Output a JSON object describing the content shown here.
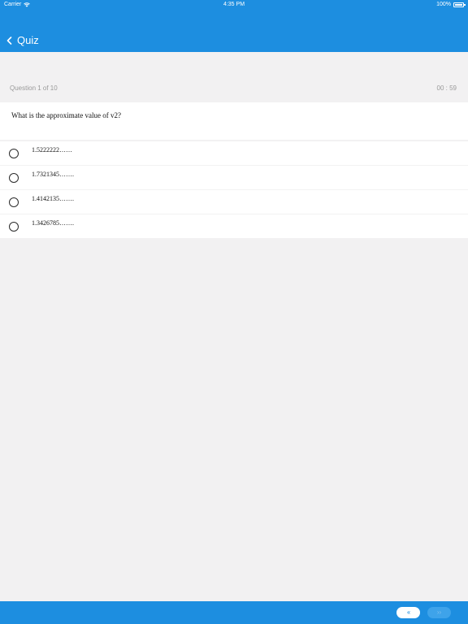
{
  "status_bar": {
    "carrier": "Carrier",
    "time": "4:35 PM",
    "battery": "100%",
    "battery_level": 1.0
  },
  "nav": {
    "title": "Quiz",
    "back_icon": "chevron-left-icon"
  },
  "quiz": {
    "counter": "Question 1 of 10",
    "timer": "00 : 59",
    "question": "What is the approximate value of v2?",
    "options": [
      {
        "label": "1.5222222……"
      },
      {
        "label": "1.7321345……."
      },
      {
        "label": "1.4142135……."
      },
      {
        "label": "1.3426785……."
      }
    ]
  },
  "footer": {
    "prev_label": "‹‹",
    "next_label": "››"
  },
  "colors": {
    "primary": "#1d8ee0",
    "background": "#f2f1f2",
    "card": "#ffffff"
  }
}
